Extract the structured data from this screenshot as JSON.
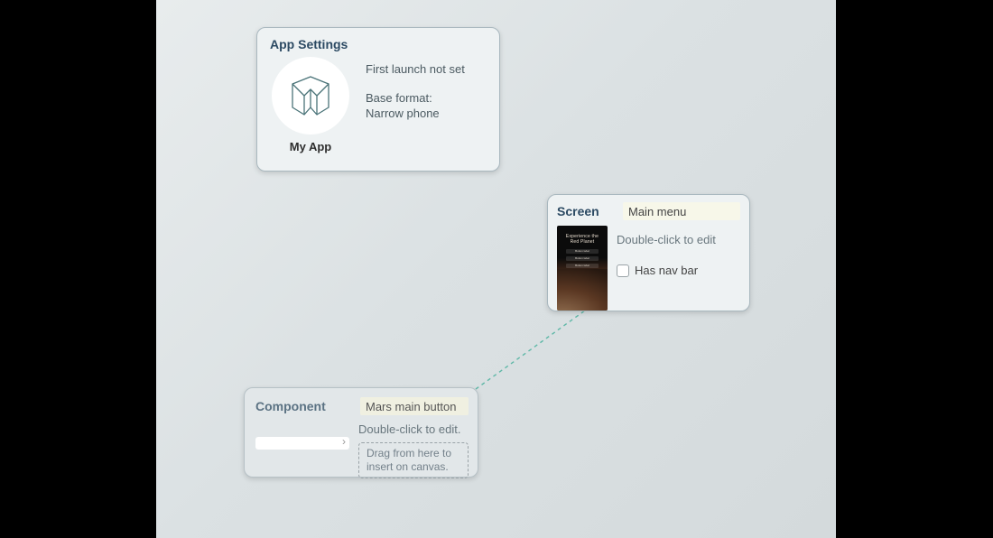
{
  "app_settings": {
    "title": "App Settings",
    "app_name": "My App",
    "first_launch_text": "First launch not set",
    "base_format_label": "Base format:",
    "base_format_value": "Narrow phone"
  },
  "screen": {
    "title": "Screen",
    "name_value": "Main menu",
    "hint": "Double-click to edit",
    "has_nav_bar_label": "Has nav bar",
    "has_nav_bar_checked": false,
    "thumb": {
      "heading_line1": "Experience the",
      "heading_line2": "Red Planet",
      "button_label": "Button label"
    }
  },
  "component": {
    "title": "Component",
    "name_value": "Mars main button",
    "hint": "Double-click to edit.",
    "drag_hint": "Drag from here to insert on canvas."
  }
}
